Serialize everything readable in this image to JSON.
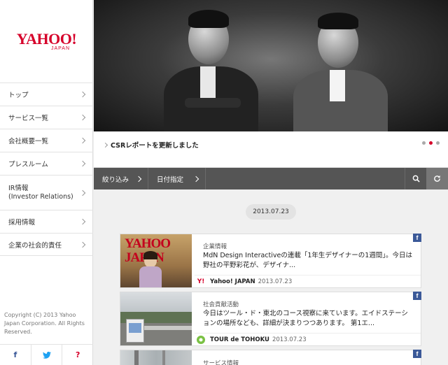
{
  "logo": {
    "main": "YAHOO!",
    "sub": "JAPAN"
  },
  "nav": [
    {
      "label": "トップ"
    },
    {
      "label": "サービス一覧"
    },
    {
      "label": "会社概要一覧"
    },
    {
      "label": "プレスルーム"
    },
    {
      "label": "IR情報",
      "label2": "(Investor Relations)"
    },
    {
      "label": "採用情報"
    },
    {
      "label": "企業の社会的責任"
    }
  ],
  "copyright": "Copyright (C) 2013 Yahoo Japan Corporation. All Rights Reserved.",
  "social": {
    "facebook": "f",
    "twitter": "t",
    "help": "?"
  },
  "hero": {
    "caption": "CSRレポートを更新しました",
    "slides_total": 3,
    "slide_active": 2
  },
  "filters": {
    "narrow": "絞り込み",
    "date": "日付指定"
  },
  "date_pill": "2013.07.23",
  "cards": [
    {
      "category": "企業情報",
      "title": "MdN Design Interactiveの連載「1年生デザイナーの1週間」。今日は野社の平野彩花が、デザイナ...",
      "source": "Yahoo! JAPAN",
      "date": "2013.07.23",
      "thumb_text": "YAHOO JAPAN"
    },
    {
      "category": "社会貢献活動",
      "title": "今日はツール・ド・東北のコース視察に来ています。エイドステーションの場所なども、詳細が決まりつつあります。 第1エ...",
      "source": "TOUR de TOHOKU",
      "date": "2013.07.23"
    },
    {
      "category": "サービス情報"
    }
  ],
  "colors": {
    "brand": "#d6002a",
    "filterbar": "#555555",
    "facebook": "#3b5998"
  }
}
